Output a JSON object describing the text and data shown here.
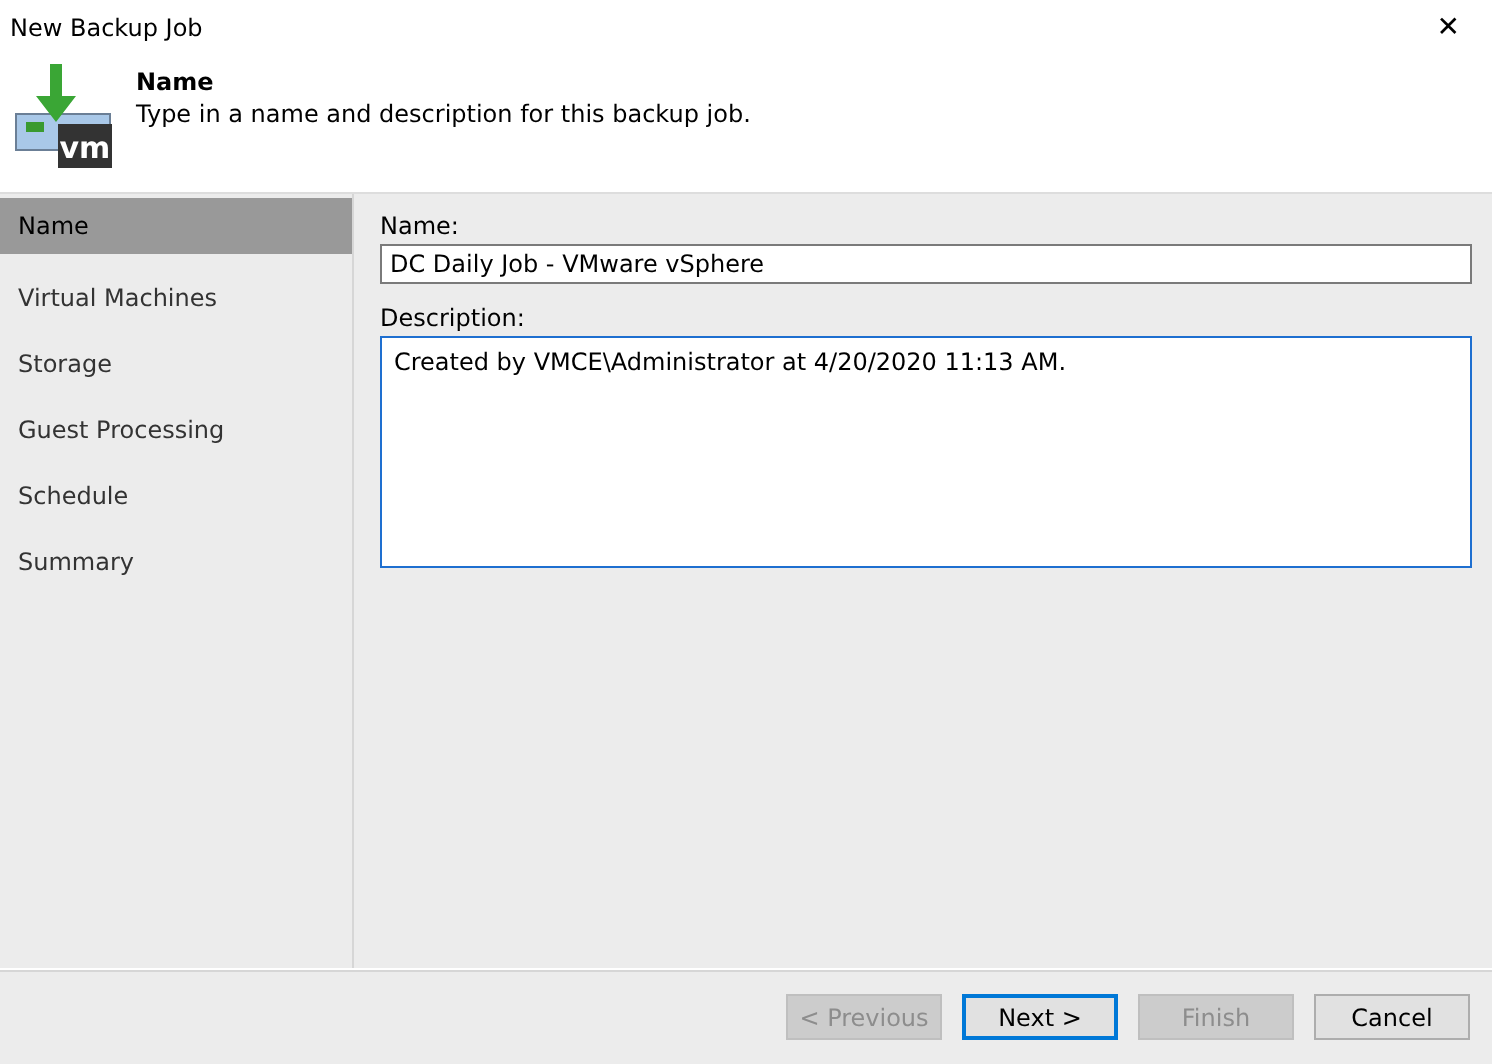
{
  "window": {
    "title": "New Backup Job",
    "close": "✕"
  },
  "header": {
    "logo_text": "vm",
    "title": "Name",
    "subtitle": "Type in a name and description for this backup job."
  },
  "sidebar": {
    "items": [
      {
        "label": "Name",
        "selected": true
      },
      {
        "label": "Virtual Machines",
        "selected": false
      },
      {
        "label": "Storage",
        "selected": false
      },
      {
        "label": "Guest Processing",
        "selected": false
      },
      {
        "label": "Schedule",
        "selected": false
      },
      {
        "label": "Summary",
        "selected": false
      }
    ]
  },
  "form": {
    "name_label": "Name:",
    "name_value": "DC Daily Job - VMware vSphere",
    "description_label": "Description:",
    "description_value": "Created by VMCE\\Administrator at 4/20/2020 11:13 AM."
  },
  "buttons": [
    {
      "label": "< Previous",
      "disabled": true,
      "focused": false
    },
    {
      "label": "Next >",
      "disabled": false,
      "focused": true
    },
    {
      "label": "Finish",
      "disabled": true,
      "focused": false
    },
    {
      "label": "Cancel",
      "disabled": false,
      "focused": false
    }
  ]
}
